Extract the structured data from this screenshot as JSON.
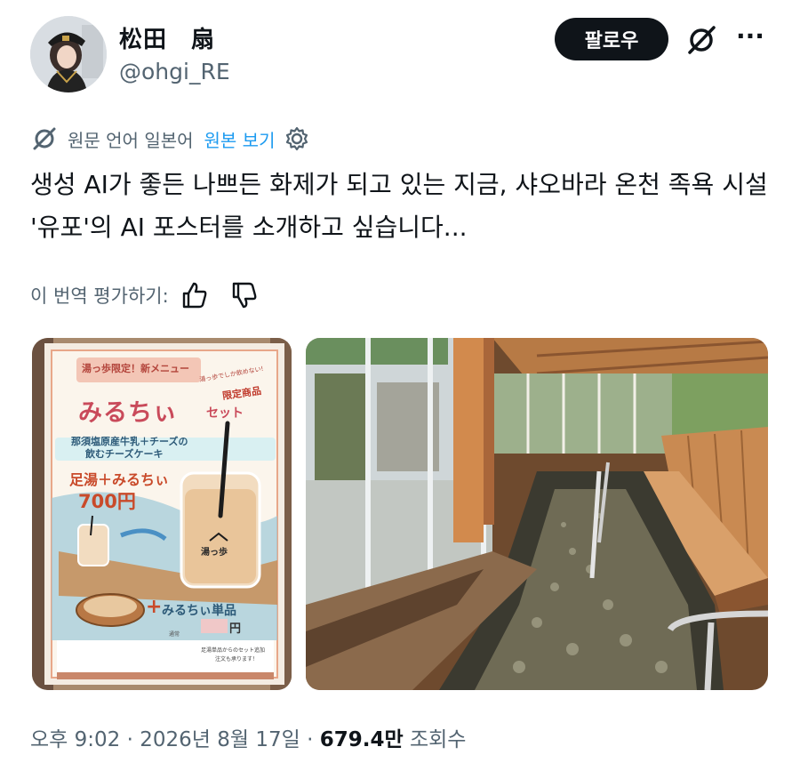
{
  "author": {
    "name": "松田　扇",
    "handle": "@ohgi_RE",
    "follow_label": "팔로우"
  },
  "translation": {
    "info": "원문 언어 일본어",
    "show_original": "원본 보기"
  },
  "tweet": {
    "text": "생성 AI가 좋든 나쁘든 화제가 되고 있는 지금, 샤오바라 온천 족욕 시설 '유포'의 AI 포스터를 소개하고 싶습니다..."
  },
  "rating": {
    "label": "이 번역 평가하기:"
  },
  "poster": {
    "banner": "湯っ歩限定！新メニュー",
    "title": "みるちぃ",
    "title_suffix": "セット",
    "limited": "限定商品",
    "limited_top": "湯っ歩でしか飲めない!",
    "subtitle_1": "那須塩原産牛乳＋チーズの",
    "subtitle_2": "飲むチーズケーキ",
    "combo": "足湯＋みるちぃ",
    "price": "700円",
    "single": "みるちぃ単品",
    "cup_logo": "湯っ歩",
    "single_price": "円",
    "normal_label": "通常",
    "fine_print_1": "足湯単品からのセット追加",
    "fine_print_2": "注文も承ります！"
  },
  "meta": {
    "time": "오후 9:02",
    "date": "2026년 8월 17일",
    "views_count": "679.4만",
    "views_label": "조회수",
    "sep": "·"
  },
  "colors": {
    "accent": "#1d9bf0",
    "text": "#0f1419",
    "secondary": "#536471",
    "follow_bg": "#0f1419"
  }
}
